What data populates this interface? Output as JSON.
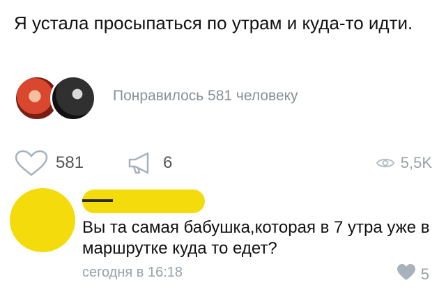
{
  "post": {
    "text": "Я устала просыпаться по утрам и куда-то идти."
  },
  "likers": {
    "summary": "Понравилось 581 человеку"
  },
  "actions": {
    "like_count": "581",
    "share_count": "6",
    "views_count": "5,5K"
  },
  "comment": {
    "text": "Вы та самая бабушка,которая в 7 утра уже в маршрутке куда то едет?",
    "time": "сегодня в 16:18",
    "like_count": "5"
  },
  "colors": {
    "redaction": "#f4dc0c",
    "muted": "#9aa0a6",
    "heart_filled": "#a9b1bb"
  }
}
